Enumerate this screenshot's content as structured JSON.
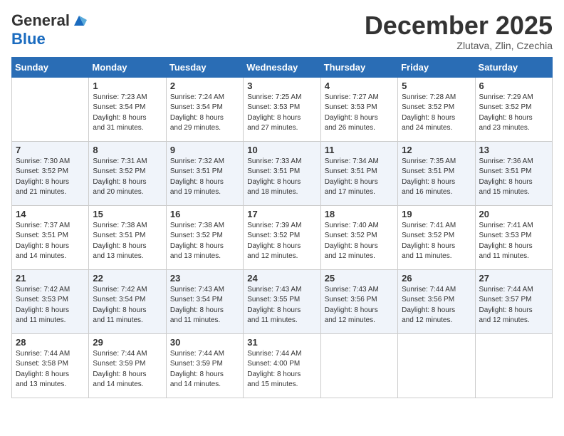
{
  "header": {
    "logo_general": "General",
    "logo_blue": "Blue",
    "month_title": "December 2025",
    "location": "Zlutava, Zlin, Czechia"
  },
  "calendar": {
    "days_of_week": [
      "Sunday",
      "Monday",
      "Tuesday",
      "Wednesday",
      "Thursday",
      "Friday",
      "Saturday"
    ],
    "weeks": [
      [
        {
          "day": "",
          "info": ""
        },
        {
          "day": "1",
          "info": "Sunrise: 7:23 AM\nSunset: 3:54 PM\nDaylight: 8 hours\nand 31 minutes."
        },
        {
          "day": "2",
          "info": "Sunrise: 7:24 AM\nSunset: 3:54 PM\nDaylight: 8 hours\nand 29 minutes."
        },
        {
          "day": "3",
          "info": "Sunrise: 7:25 AM\nSunset: 3:53 PM\nDaylight: 8 hours\nand 27 minutes."
        },
        {
          "day": "4",
          "info": "Sunrise: 7:27 AM\nSunset: 3:53 PM\nDaylight: 8 hours\nand 26 minutes."
        },
        {
          "day": "5",
          "info": "Sunrise: 7:28 AM\nSunset: 3:52 PM\nDaylight: 8 hours\nand 24 minutes."
        },
        {
          "day": "6",
          "info": "Sunrise: 7:29 AM\nSunset: 3:52 PM\nDaylight: 8 hours\nand 23 minutes."
        }
      ],
      [
        {
          "day": "7",
          "info": "Sunrise: 7:30 AM\nSunset: 3:52 PM\nDaylight: 8 hours\nand 21 minutes."
        },
        {
          "day": "8",
          "info": "Sunrise: 7:31 AM\nSunset: 3:52 PM\nDaylight: 8 hours\nand 20 minutes."
        },
        {
          "day": "9",
          "info": "Sunrise: 7:32 AM\nSunset: 3:51 PM\nDaylight: 8 hours\nand 19 minutes."
        },
        {
          "day": "10",
          "info": "Sunrise: 7:33 AM\nSunset: 3:51 PM\nDaylight: 8 hours\nand 18 minutes."
        },
        {
          "day": "11",
          "info": "Sunrise: 7:34 AM\nSunset: 3:51 PM\nDaylight: 8 hours\nand 17 minutes."
        },
        {
          "day": "12",
          "info": "Sunrise: 7:35 AM\nSunset: 3:51 PM\nDaylight: 8 hours\nand 16 minutes."
        },
        {
          "day": "13",
          "info": "Sunrise: 7:36 AM\nSunset: 3:51 PM\nDaylight: 8 hours\nand 15 minutes."
        }
      ],
      [
        {
          "day": "14",
          "info": "Sunrise: 7:37 AM\nSunset: 3:51 PM\nDaylight: 8 hours\nand 14 minutes."
        },
        {
          "day": "15",
          "info": "Sunrise: 7:38 AM\nSunset: 3:51 PM\nDaylight: 8 hours\nand 13 minutes."
        },
        {
          "day": "16",
          "info": "Sunrise: 7:38 AM\nSunset: 3:52 PM\nDaylight: 8 hours\nand 13 minutes."
        },
        {
          "day": "17",
          "info": "Sunrise: 7:39 AM\nSunset: 3:52 PM\nDaylight: 8 hours\nand 12 minutes."
        },
        {
          "day": "18",
          "info": "Sunrise: 7:40 AM\nSunset: 3:52 PM\nDaylight: 8 hours\nand 12 minutes."
        },
        {
          "day": "19",
          "info": "Sunrise: 7:41 AM\nSunset: 3:52 PM\nDaylight: 8 hours\nand 11 minutes."
        },
        {
          "day": "20",
          "info": "Sunrise: 7:41 AM\nSunset: 3:53 PM\nDaylight: 8 hours\nand 11 minutes."
        }
      ],
      [
        {
          "day": "21",
          "info": "Sunrise: 7:42 AM\nSunset: 3:53 PM\nDaylight: 8 hours\nand 11 minutes."
        },
        {
          "day": "22",
          "info": "Sunrise: 7:42 AM\nSunset: 3:54 PM\nDaylight: 8 hours\nand 11 minutes."
        },
        {
          "day": "23",
          "info": "Sunrise: 7:43 AM\nSunset: 3:54 PM\nDaylight: 8 hours\nand 11 minutes."
        },
        {
          "day": "24",
          "info": "Sunrise: 7:43 AM\nSunset: 3:55 PM\nDaylight: 8 hours\nand 11 minutes."
        },
        {
          "day": "25",
          "info": "Sunrise: 7:43 AM\nSunset: 3:56 PM\nDaylight: 8 hours\nand 12 minutes."
        },
        {
          "day": "26",
          "info": "Sunrise: 7:44 AM\nSunset: 3:56 PM\nDaylight: 8 hours\nand 12 minutes."
        },
        {
          "day": "27",
          "info": "Sunrise: 7:44 AM\nSunset: 3:57 PM\nDaylight: 8 hours\nand 12 minutes."
        }
      ],
      [
        {
          "day": "28",
          "info": "Sunrise: 7:44 AM\nSunset: 3:58 PM\nDaylight: 8 hours\nand 13 minutes."
        },
        {
          "day": "29",
          "info": "Sunrise: 7:44 AM\nSunset: 3:59 PM\nDaylight: 8 hours\nand 14 minutes."
        },
        {
          "day": "30",
          "info": "Sunrise: 7:44 AM\nSunset: 3:59 PM\nDaylight: 8 hours\nand 14 minutes."
        },
        {
          "day": "31",
          "info": "Sunrise: 7:44 AM\nSunset: 4:00 PM\nDaylight: 8 hours\nand 15 minutes."
        },
        {
          "day": "",
          "info": ""
        },
        {
          "day": "",
          "info": ""
        },
        {
          "day": "",
          "info": ""
        }
      ]
    ]
  }
}
